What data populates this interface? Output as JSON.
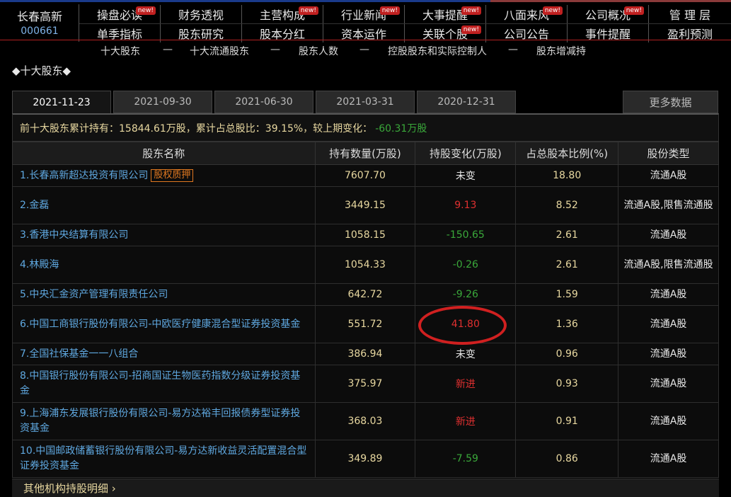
{
  "stock": {
    "name": "长春高新",
    "code": "000661"
  },
  "menu_row1": [
    {
      "label": "操盘必读",
      "new": "new!"
    },
    {
      "label": "财务透视",
      "new": ""
    },
    {
      "label": "主营构成",
      "new": "new!"
    },
    {
      "label": "行业新闻",
      "new": "new!"
    },
    {
      "label": "大事提醒",
      "new": "new!"
    },
    {
      "label": "八面来风",
      "new": "new!"
    },
    {
      "label": "公司概况",
      "new": "new!"
    },
    {
      "label": "管 理 层",
      "new": ""
    }
  ],
  "menu_row2": [
    {
      "label": "单季指标",
      "new": ""
    },
    {
      "label": "股东研究",
      "new": ""
    },
    {
      "label": "股本分红",
      "new": ""
    },
    {
      "label": "资本运作",
      "new": ""
    },
    {
      "label": "关联个股",
      "new": "new!"
    },
    {
      "label": "公司公告",
      "new": ""
    },
    {
      "label": "事件提醒",
      "new": ""
    },
    {
      "label": "盈利预测",
      "new": ""
    }
  ],
  "subnav": {
    "items": [
      "十大股东",
      "十大流通股东",
      "股东人数",
      "控股股东和实际控制人",
      "股东增减持"
    ],
    "separator": "—"
  },
  "section_title": "◆十大股东◆",
  "tabs": [
    "2021-11-23",
    "2021-09-30",
    "2021-06-30",
    "2021-03-31",
    "2020-12-31"
  ],
  "more_data": "更多数据",
  "summary": {
    "text": "前十大股东累计持有：15844.61万股，累计占总股比：39.15%，较上期变化：",
    "change": "-60.31万股"
  },
  "table": {
    "headers": [
      "股东名称",
      "持有数量(万股)",
      "持股变化(万股)",
      "占总股本比例(%)",
      "股份类型"
    ],
    "rows": [
      {
        "name": "1.长春高新超达投资有限公司",
        "badge": "股权质押",
        "qty": "7607.70",
        "change": "未变",
        "dir": "same",
        "pct": "18.80",
        "type": "流通A股"
      },
      {
        "name": "2.金磊",
        "badge": "",
        "qty": "3449.15",
        "change": "9.13",
        "dir": "up",
        "pct": "8.52",
        "type": "流通A股,限售流通股"
      },
      {
        "name": "3.香港中央结算有限公司",
        "badge": "",
        "qty": "1058.15",
        "change": "-150.65",
        "dir": "down",
        "pct": "2.61",
        "type": "流通A股"
      },
      {
        "name": "4.林殿海",
        "badge": "",
        "qty": "1054.33",
        "change": "-0.26",
        "dir": "down",
        "pct": "2.61",
        "type": "流通A股,限售流通股"
      },
      {
        "name": "5.中央汇金资产管理有限责任公司",
        "badge": "",
        "qty": "642.72",
        "change": "-9.26",
        "dir": "down",
        "pct": "1.59",
        "type": "流通A股"
      },
      {
        "name": "6.中国工商银行股份有限公司-中欧医疗健康混合型证券投资基金",
        "badge": "",
        "qty": "551.72",
        "change": "41.80",
        "dir": "up",
        "pct": "1.36",
        "type": "流通A股"
      },
      {
        "name": "7.全国社保基金一一八组合",
        "badge": "",
        "qty": "386.94",
        "change": "未变",
        "dir": "same",
        "pct": "0.96",
        "type": "流通A股"
      },
      {
        "name": "8.中国银行股份有限公司-招商国证生物医药指数分级证券投资基金",
        "badge": "",
        "qty": "375.97",
        "change": "新进",
        "dir": "new",
        "pct": "0.93",
        "type": "流通A股"
      },
      {
        "name": "9.上海浦东发展银行股份有限公司-易方达裕丰回报债券型证券投资基金",
        "badge": "",
        "qty": "368.03",
        "change": "新进",
        "dir": "new",
        "pct": "0.91",
        "type": "流通A股"
      },
      {
        "name": "10.中国邮政储蓄银行股份有限公司-易方达新收益灵活配置混合型证券投资基金",
        "badge": "",
        "qty": "349.89",
        "change": "-7.59",
        "dir": "down",
        "pct": "0.86",
        "type": "流通A股"
      }
    ]
  },
  "footer": "其他机构持股明细 ›",
  "colors": {
    "link": "#5fa8e0",
    "value": "#e8d8a0",
    "up": "#e03030",
    "down": "#3aa83a",
    "highlight_circle": "#d02020"
  }
}
